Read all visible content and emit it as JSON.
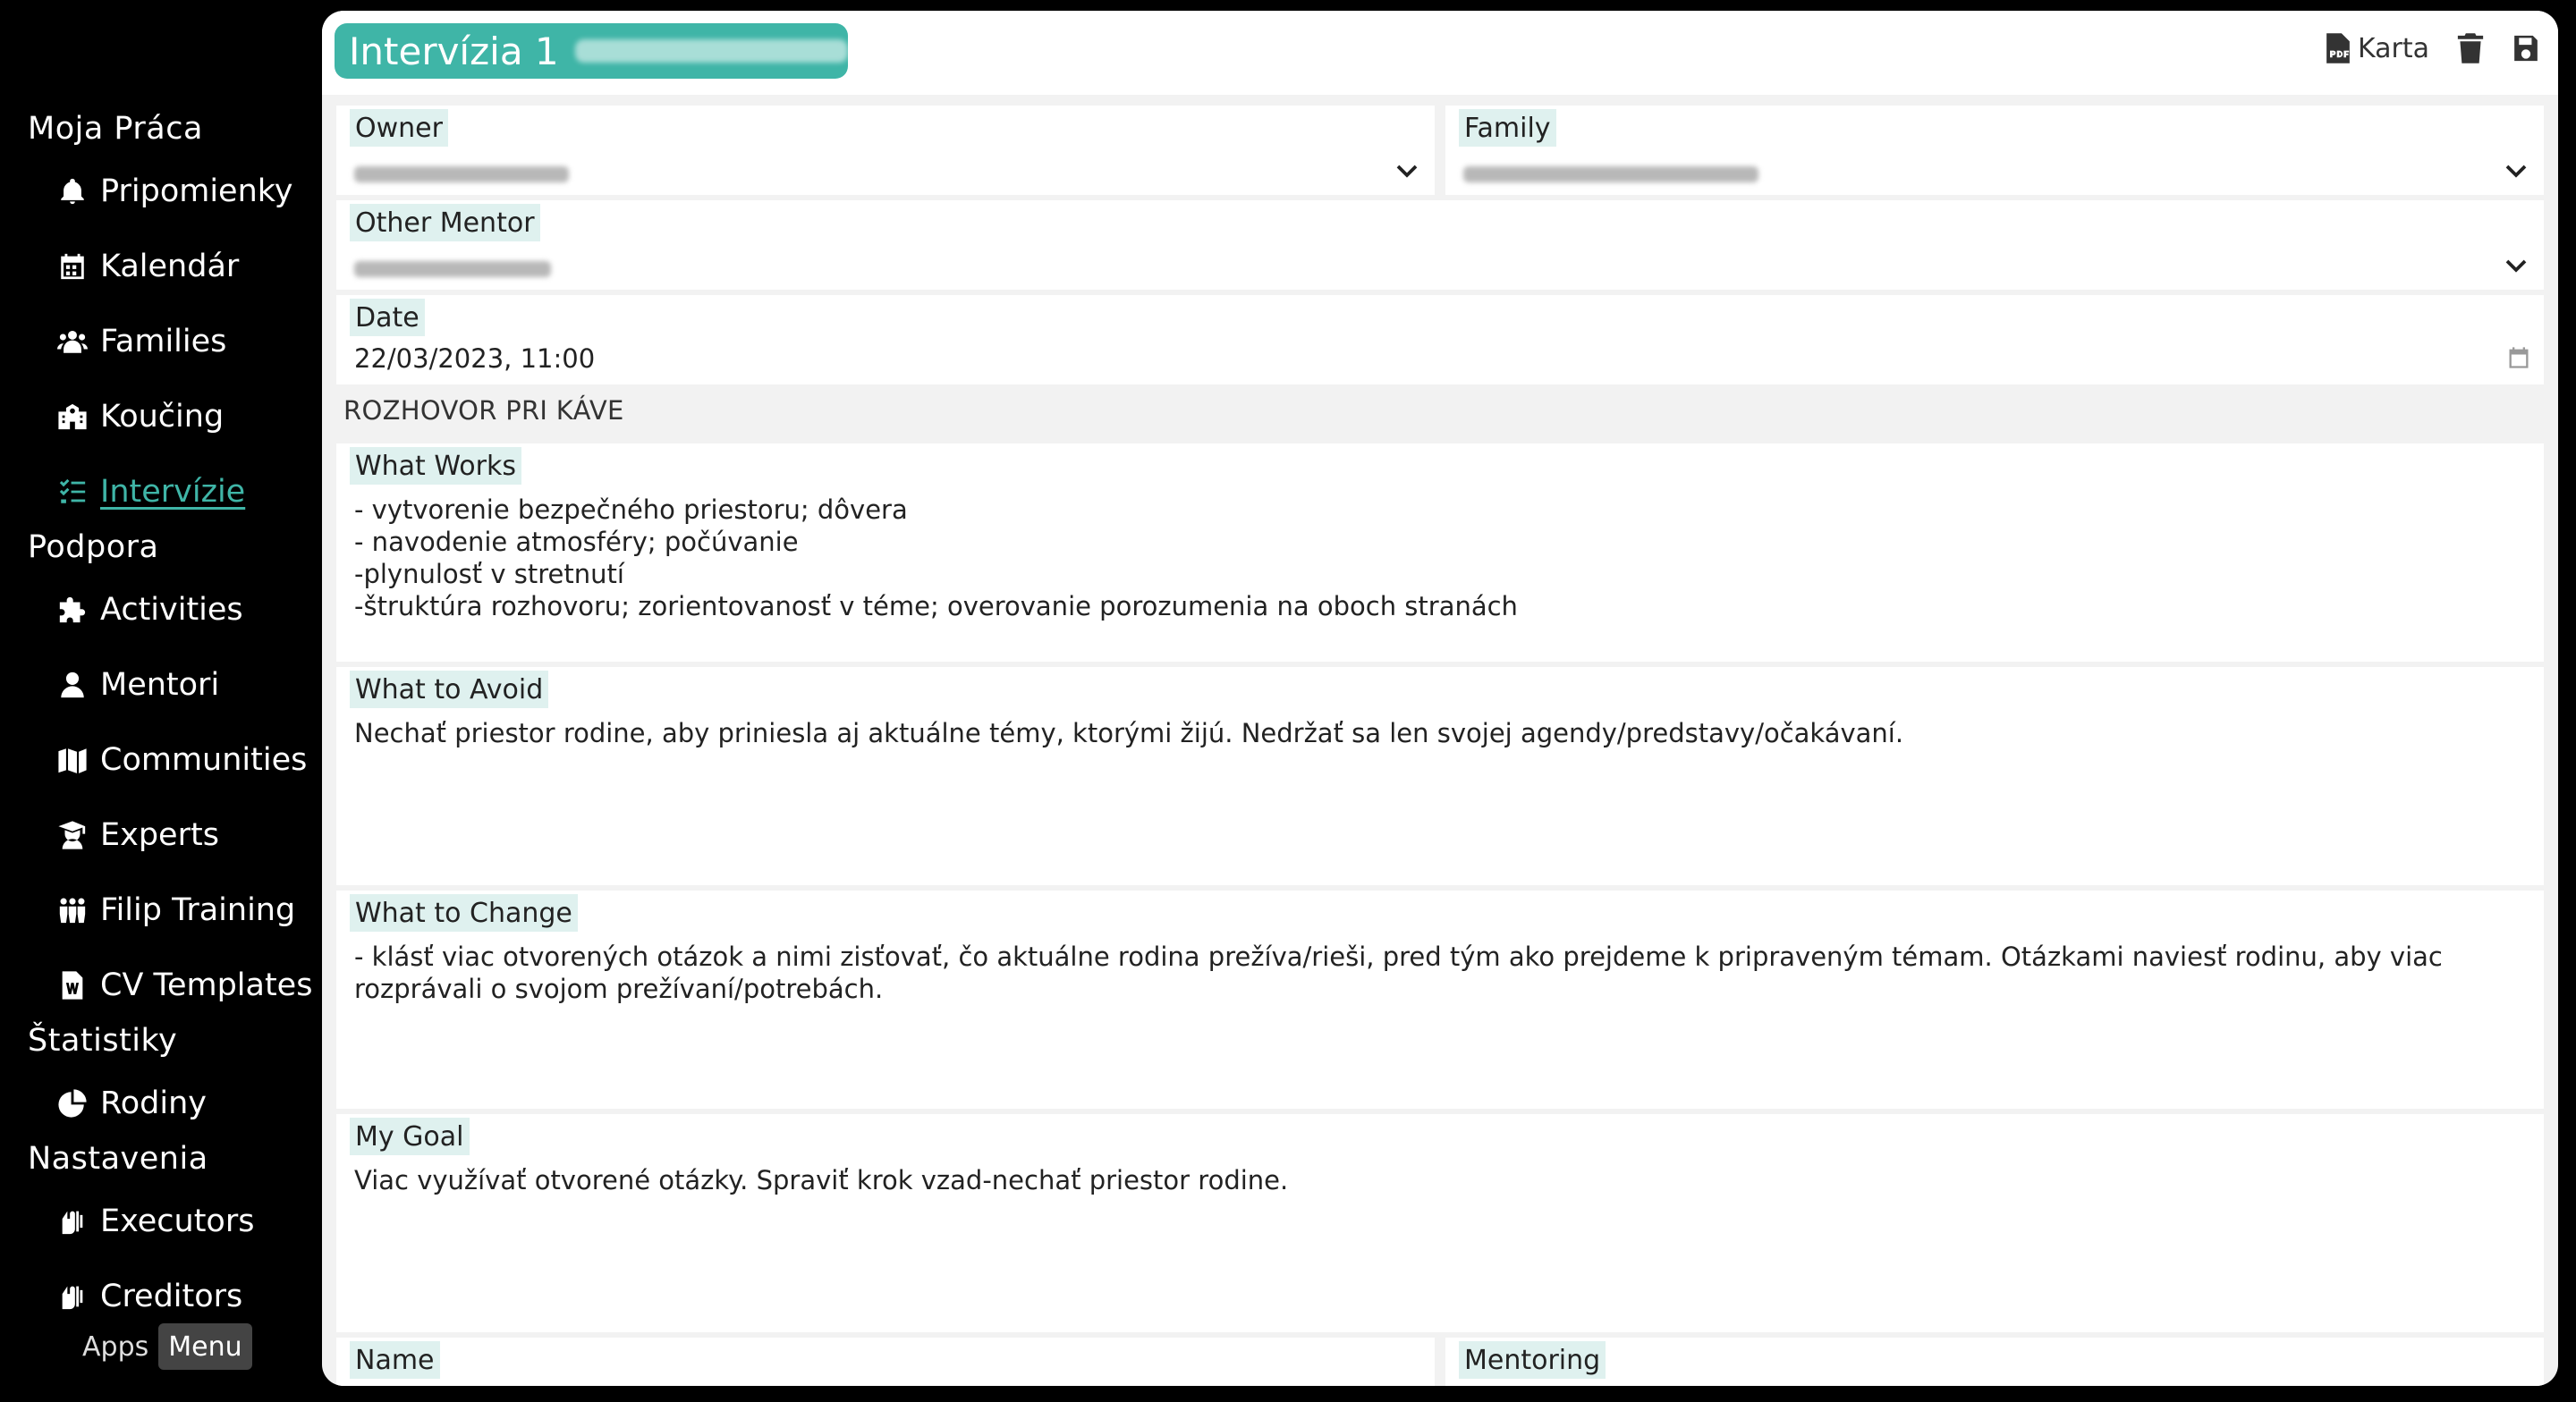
{
  "sidebar": {
    "sections": [
      {
        "title": "Moja Práca"
      },
      {
        "title": "Podpora"
      },
      {
        "title": "Štatistiky"
      },
      {
        "title": "Nastavenia"
      }
    ],
    "items": [
      {
        "label": "Pripomienky",
        "icon": "bell-icon"
      },
      {
        "label": "Kalendár",
        "icon": "calendar-icon"
      },
      {
        "label": "Families",
        "icon": "users-icon"
      },
      {
        "label": "Koučing",
        "icon": "school-icon"
      },
      {
        "label": "Intervízie",
        "icon": "tasks-icon",
        "active": true
      },
      {
        "label": "Activities",
        "icon": "puzzle-icon"
      },
      {
        "label": "Mentori",
        "icon": "user-icon"
      },
      {
        "label": "Communities",
        "icon": "map-icon"
      },
      {
        "label": "Experts",
        "icon": "graduate-icon"
      },
      {
        "label": "Filip Training",
        "icon": "people-group-icon"
      },
      {
        "label": "CV Templates",
        "icon": "word-file-icon"
      },
      {
        "label": "Rodiny",
        "icon": "pie-chart-icon"
      },
      {
        "label": "Executors",
        "icon": "hands-icon"
      },
      {
        "label": "Creditors",
        "icon": "hands-icon"
      }
    ],
    "toggle": {
      "apps": "Apps",
      "menu": "Menu"
    }
  },
  "header": {
    "title": "Intervízia 1",
    "card_label": "Karta"
  },
  "form": {
    "owner_label": "Owner",
    "family_label": "Family",
    "other_mentor_label": "Other Mentor",
    "date_label": "Date",
    "date_value": "22/03/2023, 11:00",
    "type_value": "ROZHOVOR PRI KÁVE",
    "what_works_label": "What Works",
    "what_works_value": "- vytvorenie bezpečného priestoru; dôvera\n- navodenie atmosféry; počúvanie\n-plynulosť v stretnutí\n-štruktúra rozhovoru; zorientovanosť v téme; overovanie porozumenia na oboch stranách",
    "what_to_avoid_label": "What to Avoid",
    "what_to_avoid_value": "Nechať priestor rodine, aby priniesla aj aktuálne témy, ktorými žijú. Nedržať sa len svojej agendy/predstavy/očakávaní.",
    "what_to_change_label": "What to Change",
    "what_to_change_value": "- klásť viac otvorených otázok a nimi zisťovať, čo aktuálne rodina prežíva/rieši, pred tým ako prejdeme k pripraveným témam. Otázkami naviesť rodinu, aby viac rozprávali o svojom prežívaní/potrebách.",
    "my_goal_label": "My Goal",
    "my_goal_value": "Viac využívať otvorené otázky. Spraviť krok vzad-nechať priestor rodine.",
    "name_label": "Name",
    "mentoring_label": "Mentoring"
  },
  "colors": {
    "accent": "#3fb5a7",
    "label_bg": "#dff1ef"
  }
}
